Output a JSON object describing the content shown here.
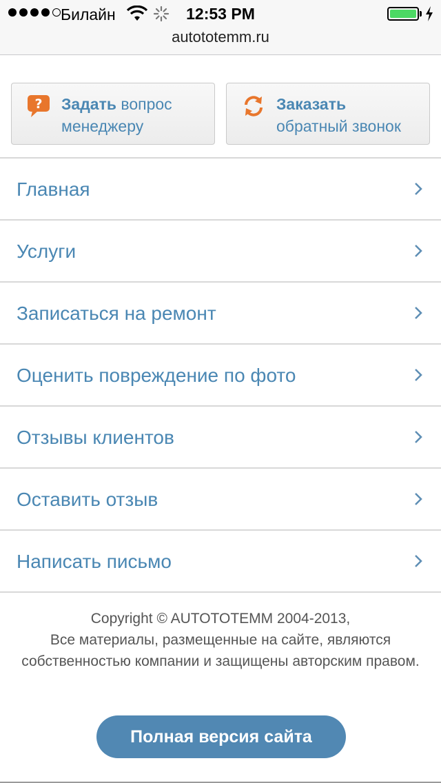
{
  "status_bar": {
    "carrier": "Билайн",
    "time": "12:53 PM",
    "battery_level": 1.0,
    "signal_bars_filled": 4,
    "signal_bars_total": 5
  },
  "browser": {
    "url": "autototemm.ru"
  },
  "actions": {
    "ask": {
      "bold": "Задать",
      "rest": " вопрос",
      "line2": "менеджеру",
      "icon": "chat-question-icon",
      "color": "#e8762c"
    },
    "callback": {
      "bold": "Заказать",
      "line2": "обратный звонок",
      "icon": "refresh-icon",
      "color": "#e8762c"
    }
  },
  "nav": {
    "items": [
      {
        "label": "Главная"
      },
      {
        "label": "Услуги"
      },
      {
        "label": "Записаться на ремонт"
      },
      {
        "label": "Оценить повреждение по фото"
      },
      {
        "label": "Отзывы клиентов"
      },
      {
        "label": "Оставить отзыв"
      },
      {
        "label": "Написать письмо"
      }
    ]
  },
  "footer": {
    "copyright_line1": "Copyright © AUTOTOTEMM 2004-2013,",
    "copyright_line2": "Все материалы, размещенные на сайте, являются собственностью компании и защищены авторским правом.",
    "full_version_label": "Полная версия сайта"
  },
  "colors": {
    "link": "#4a87b3",
    "button": "#5188b3",
    "accent": "#e8762c"
  }
}
